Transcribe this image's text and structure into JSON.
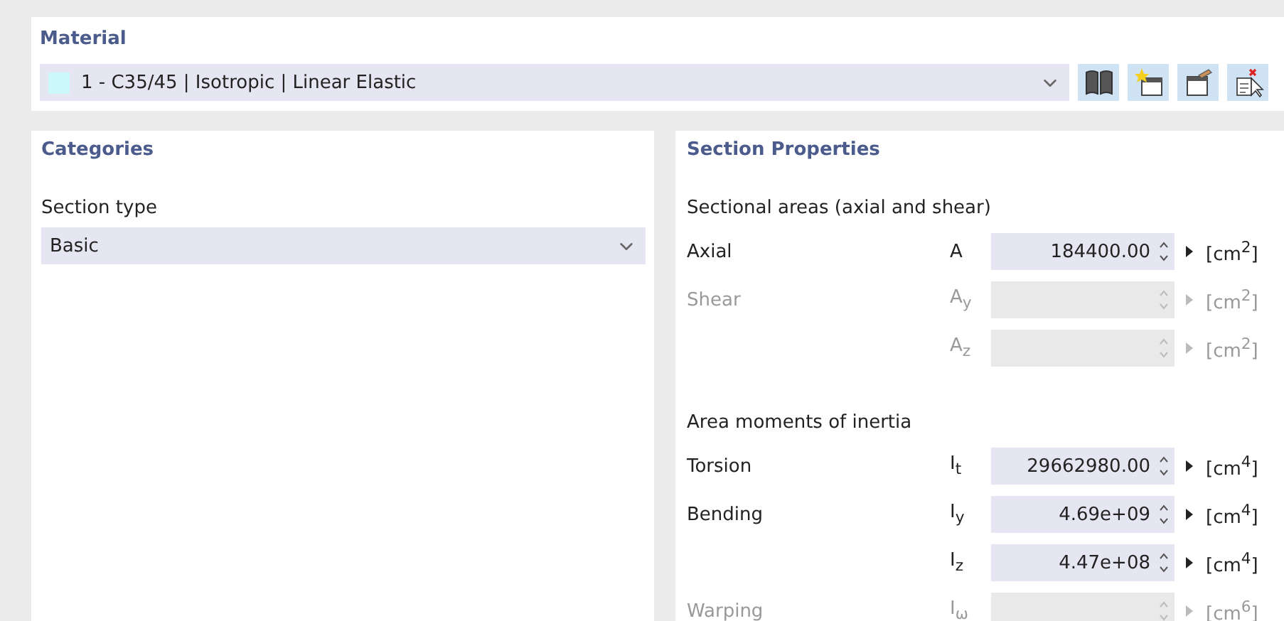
{
  "material": {
    "title": "Material",
    "value": "1 - C35/45 | Isotropic | Linear Elastic",
    "color": "#ccf7fb"
  },
  "categories": {
    "title": "Categories",
    "section_type": {
      "label": "Section type",
      "value": "Basic"
    }
  },
  "section_properties": {
    "title": "Section Properties",
    "groups": [
      {
        "title": "Sectional areas (axial and shear)",
        "rows": [
          {
            "label": "Axial",
            "symbol": "A",
            "value": "184400.00",
            "unit": "[cm$^{2}$]",
            "disabled": false
          },
          {
            "label": "Shear",
            "symbol": "A$_{y}$",
            "unit": "[cm$^{2}$]",
            "disabled": true
          },
          {
            "symbol": "A$_{z}$",
            "unit": "[cm$^{2}$]",
            "disabled": true
          }
        ]
      },
      {
        "title": "Area moments of inertia",
        "rows": [
          {
            "label": "Torsion",
            "symbol": "I$_{t}$",
            "value": "29662980.00",
            "unit": "[cm$^{4}$]",
            "disabled": false
          },
          {
            "label": "Bending",
            "symbol": "I$_{y}$",
            "value": "4.69e+09",
            "unit": "[cm$^{4}$]",
            "disabled": false
          },
          {
            "symbol": "I$_{z}$",
            "value": "4.47e+08",
            "unit": "[cm$^{4}$]",
            "disabled": false
          },
          {
            "label": "Warping",
            "symbol": "I$_{ω}$",
            "unit": "[cm$^{6}$]",
            "disabled": true
          }
        ]
      }
    ]
  }
}
